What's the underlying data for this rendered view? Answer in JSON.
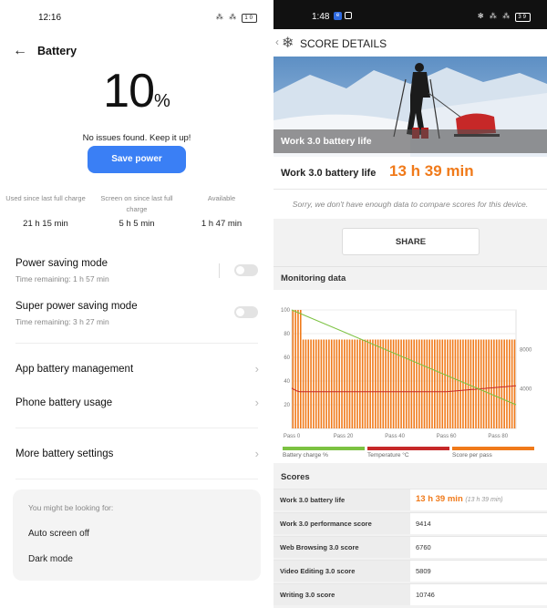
{
  "left": {
    "status": {
      "time": "12:16",
      "icons": "⁂ ⁂",
      "battery": "10"
    },
    "header": {
      "title": "Battery"
    },
    "battery_percent": "10",
    "battery_unit": "%",
    "status_message": "No issues found. Keep it up!",
    "save_button": "Save power",
    "stats": [
      {
        "label": "Used since last full charge",
        "value": "21 h 15 min"
      },
      {
        "label": "Screen on since last full charge",
        "value": "5 h 5 min"
      },
      {
        "label": "Available",
        "value": "1 h 47 min"
      }
    ],
    "power_saving": {
      "label": "Power saving mode",
      "sub": "Time remaining:  1 h 57 min"
    },
    "super_power_saving": {
      "label": "Super power saving mode",
      "sub": "Time remaining:  3 h 27 min"
    },
    "menu": {
      "app_battery": "App battery management",
      "phone_usage": "Phone battery usage",
      "more_settings": "More battery settings"
    },
    "suggestions": {
      "heading": "You might be looking for:",
      "items": [
        "Auto screen off",
        "Dark mode"
      ]
    }
  },
  "right": {
    "status": {
      "time": "1:48",
      "icons": "✻ ⁂ ⁂",
      "battery": "39"
    },
    "header": {
      "title": "SCORE DETAILS"
    },
    "hero_label": "Work 3.0 battery life",
    "score_label": "Work 3.0 battery life",
    "score_value": "13 h 39 min",
    "sorry_text": "Sorry, we don't have enough data to compare scores for this device.",
    "share_button": "SHARE",
    "monitoring_heading": "Monitoring data",
    "legend": [
      {
        "label": "Battery charge %",
        "color": "#7cc242"
      },
      {
        "label": "Temperature °C",
        "color": "#c62828"
      },
      {
        "label": "Score per pass",
        "color": "#f07a1a"
      }
    ],
    "scores_heading": "Scores",
    "scores": [
      {
        "name": "Work 3.0 battery life",
        "value": "13 h 39 min",
        "sub": "(13 h 39 min)",
        "highlight": true
      },
      {
        "name": "Work 3.0 performance score",
        "value": "9414"
      },
      {
        "name": "Web Browsing 3.0 score",
        "value": "6760"
      },
      {
        "name": "Video Editing 3.0 score",
        "value": "5809"
      },
      {
        "name": "Writing 3.0 score",
        "value": "10746"
      }
    ]
  },
  "chart_data": {
    "type": "bar",
    "x_ticks": [
      "Pass 0",
      "Pass 20",
      "Pass 40",
      "Pass 60",
      "Pass 80"
    ],
    "y_left_ticks": [
      "100",
      "80",
      "60",
      "40",
      "20"
    ],
    "y_right_ticks": [
      "8000",
      "4000"
    ],
    "ylim_left": [
      0,
      100
    ],
    "ylim_right": [
      0,
      12000
    ],
    "passes": 87,
    "series": [
      {
        "name": "Score per pass",
        "axis": "right",
        "values": [
          9000,
          9000,
          9000,
          9000,
          5200,
          9800
        ]
      },
      {
        "name": "Battery charge %",
        "axis": "left",
        "start": 100,
        "end": 20
      },
      {
        "name": "Temperature °C",
        "axis": "left",
        "start": 34,
        "plateau": 31,
        "end": 36
      }
    ],
    "grid": true
  }
}
